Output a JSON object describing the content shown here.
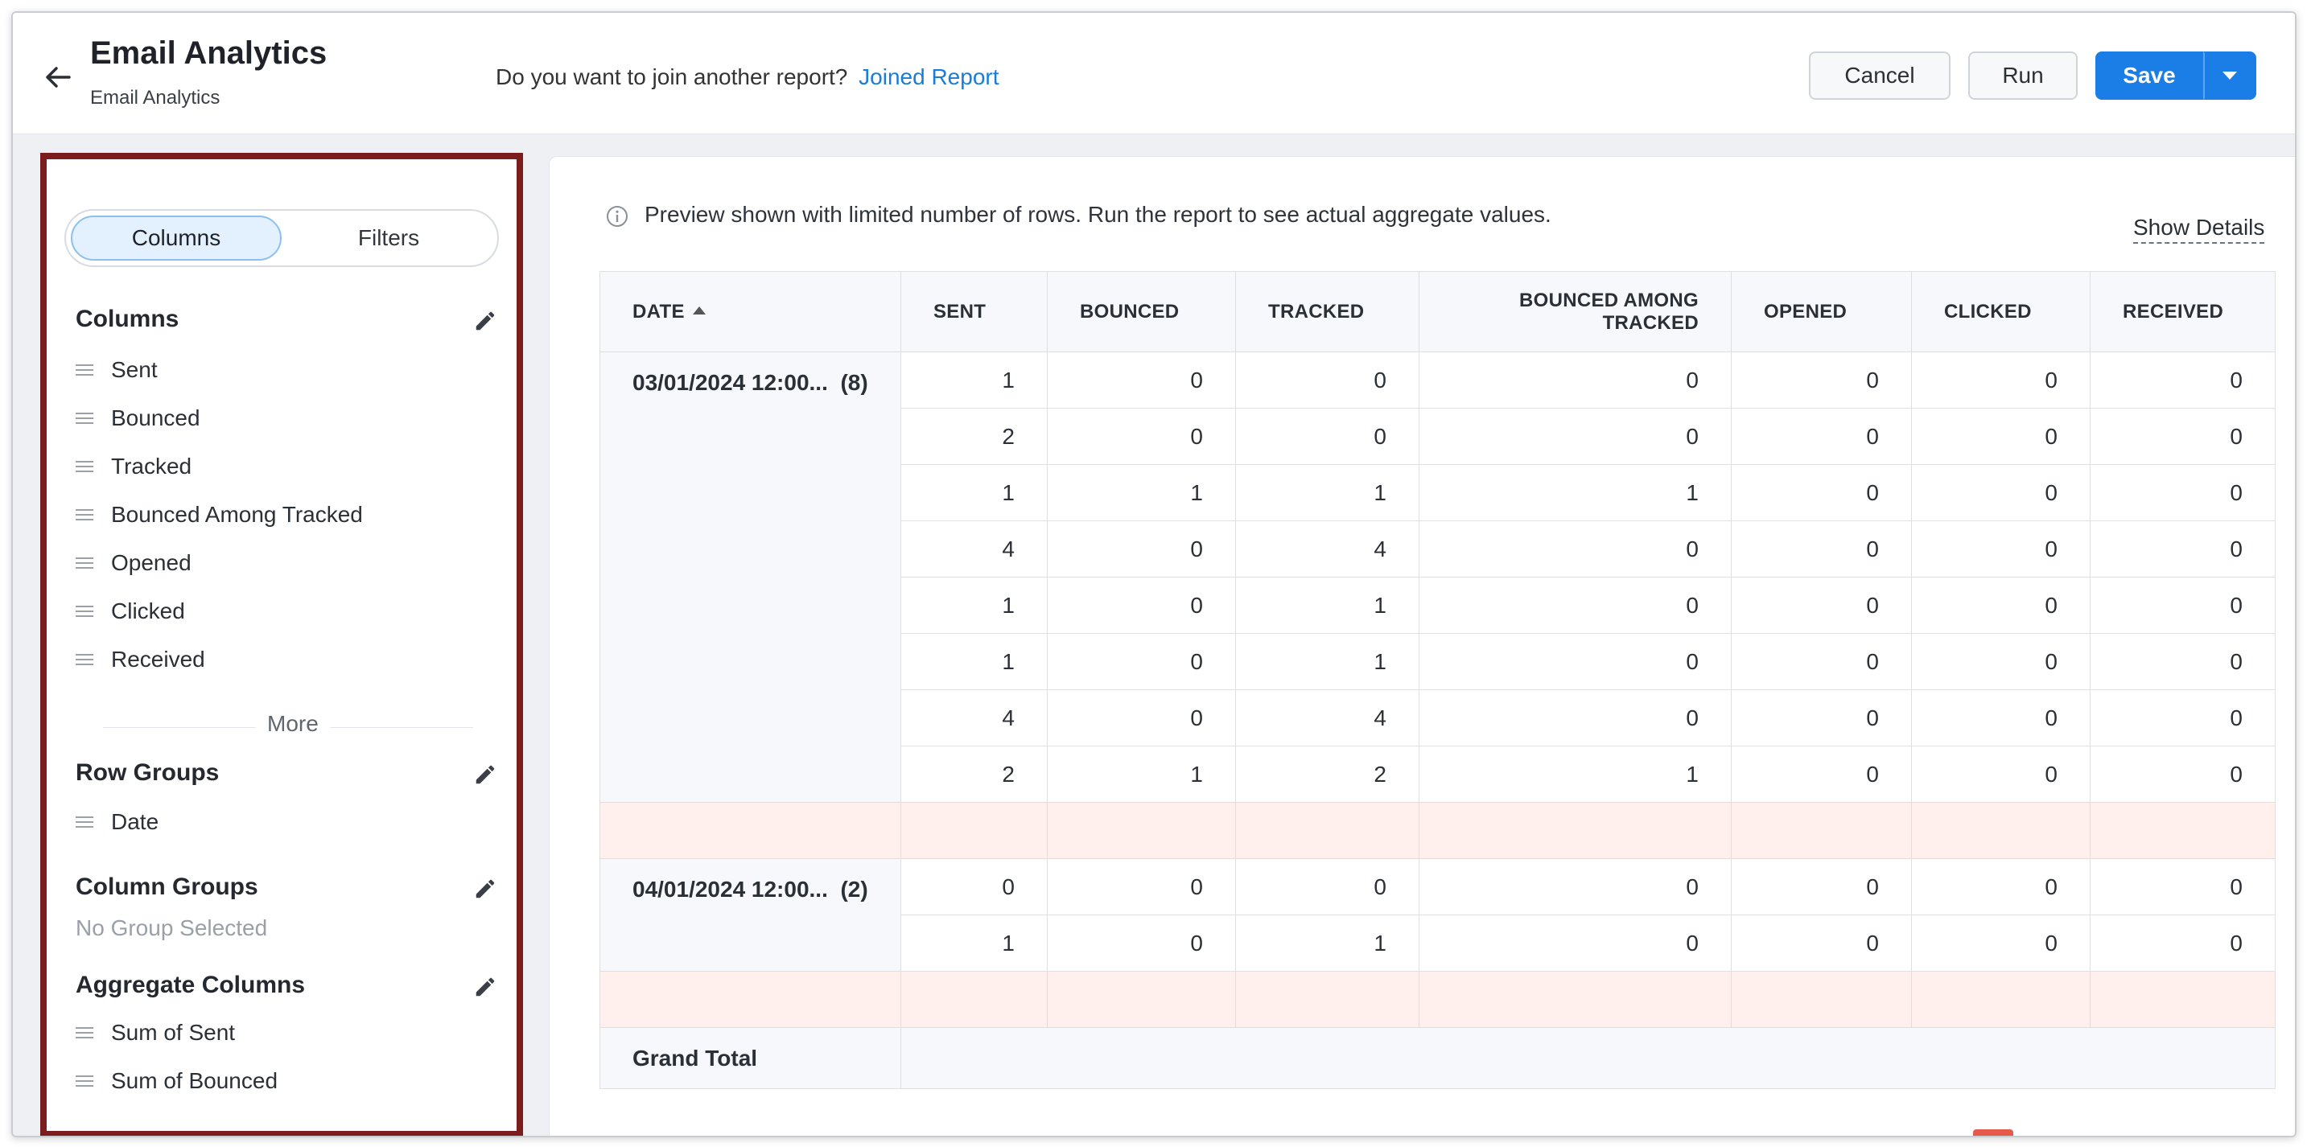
{
  "header": {
    "title": "Email Analytics",
    "subtitle": "Email Analytics",
    "join_question": "Do you want to join another report?",
    "join_link": "Joined Report",
    "cancel": "Cancel",
    "run": "Run",
    "save": "Save"
  },
  "sidebar": {
    "tab_columns": "Columns",
    "tab_filters": "Filters",
    "columns_title": "Columns",
    "columns": [
      "Sent",
      "Bounced",
      "Tracked",
      "Bounced Among Tracked",
      "Opened",
      "Clicked",
      "Received"
    ],
    "more": "More",
    "row_groups_title": "Row Groups",
    "row_groups": [
      "Date"
    ],
    "column_groups_title": "Column Groups",
    "column_groups_empty": "No Group Selected",
    "aggregate_title": "Aggregate Columns",
    "aggregates": [
      "Sum of Sent",
      "Sum of Bounced"
    ]
  },
  "main": {
    "info_text": "Preview shown with limited number of rows. Run the report to see actual aggregate values.",
    "show_details": "Show Details",
    "headers": {
      "date": "DATE",
      "sent": "SENT",
      "bounced": "BOUNCED",
      "tracked": "TRACKED",
      "bounced_tracked": "BOUNCED AMONG TRACKED",
      "opened": "OPENED",
      "clicked": "CLICKED",
      "received": "RECEIVED"
    },
    "groups": [
      {
        "label": "03/01/2024 12:00...",
        "count": "(8)",
        "rows": [
          [
            "1",
            "0",
            "0",
            "0",
            "0",
            "0",
            "0"
          ],
          [
            "2",
            "0",
            "0",
            "0",
            "0",
            "0",
            "0"
          ],
          [
            "1",
            "1",
            "1",
            "1",
            "0",
            "0",
            "0"
          ],
          [
            "4",
            "0",
            "4",
            "0",
            "0",
            "0",
            "0"
          ],
          [
            "1",
            "0",
            "1",
            "0",
            "0",
            "0",
            "0"
          ],
          [
            "1",
            "0",
            "1",
            "0",
            "0",
            "0",
            "0"
          ],
          [
            "4",
            "0",
            "4",
            "0",
            "0",
            "0",
            "0"
          ],
          [
            "2",
            "1",
            "2",
            "1",
            "0",
            "0",
            "0"
          ]
        ]
      },
      {
        "label": "04/01/2024 12:00...",
        "count": "(2)",
        "rows": [
          [
            "0",
            "0",
            "0",
            "0",
            "0",
            "0",
            "0"
          ],
          [
            "1",
            "0",
            "1",
            "0",
            "0",
            "0",
            "0"
          ]
        ]
      }
    ],
    "grand_total": "Grand Total"
  }
}
